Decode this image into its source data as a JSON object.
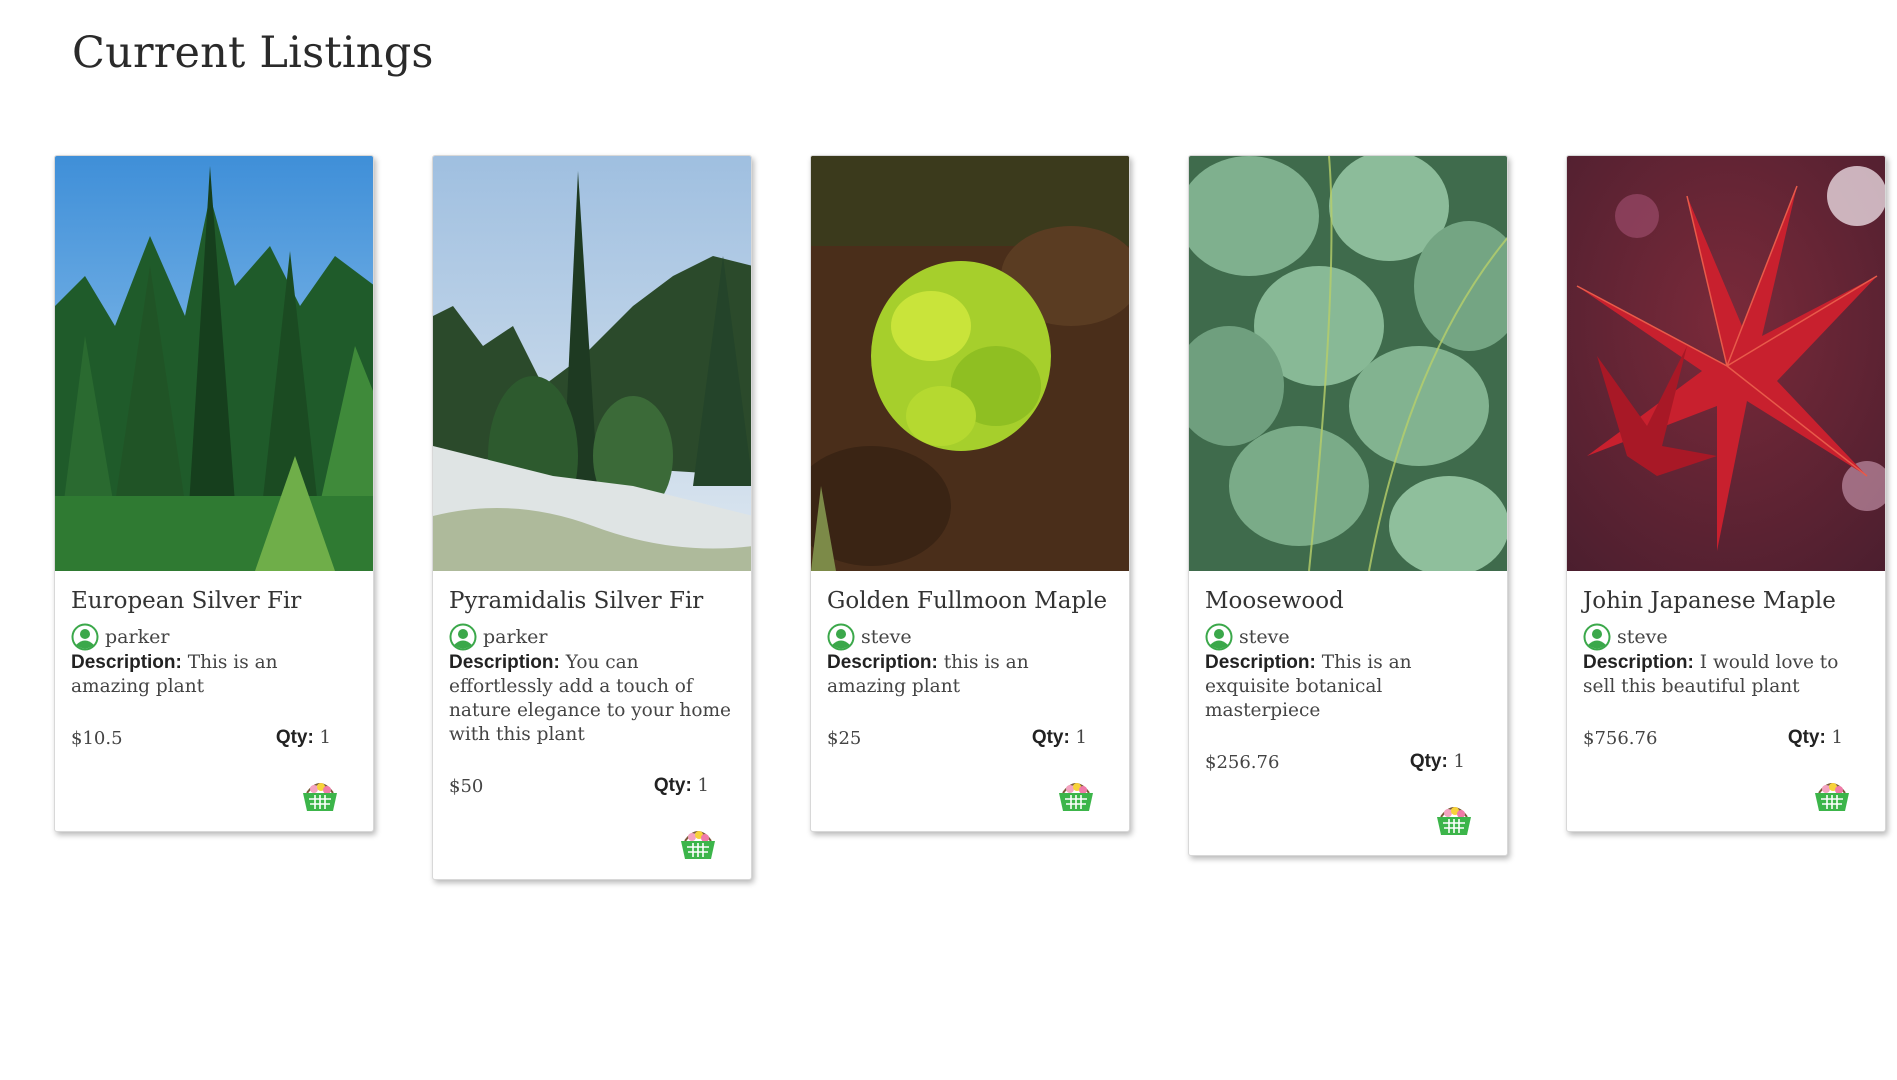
{
  "page": {
    "title": "Current Listings"
  },
  "labels": {
    "description": "Description:",
    "qty": "Qty:"
  },
  "listings": [
    {
      "name": "European Silver Fir",
      "seller": "parker",
      "description": "This is an amazing plant",
      "price": "$10.5",
      "qty": "1",
      "photo": "evergreen-forest"
    },
    {
      "name": "Pyramidalis Silver Fir",
      "seller": "parker",
      "description": "You can effortlessly add a touch of nature elegance to your home with this plant",
      "price": "$50",
      "qty": "1",
      "photo": "snowy-garden-fir"
    },
    {
      "name": "Golden Fullmoon Maple",
      "seller": "steve",
      "description": "this is an amazing plant",
      "price": "$25",
      "qty": "1",
      "photo": "golden-maple-shrub"
    },
    {
      "name": "Moosewood",
      "seller": "steve",
      "description": "This is an exquisite botanical masterpiece",
      "price": "$256.76",
      "qty": "1",
      "photo": "green-leaves"
    },
    {
      "name": "Johin Japanese Maple",
      "seller": "steve",
      "description": "I would love to sell this beautiful plant",
      "price": "$756.76",
      "qty": "1",
      "photo": "red-maple-leaves"
    }
  ],
  "colors": {
    "accent_green": "#3ba84a",
    "basket_green": "#3cb54a"
  }
}
